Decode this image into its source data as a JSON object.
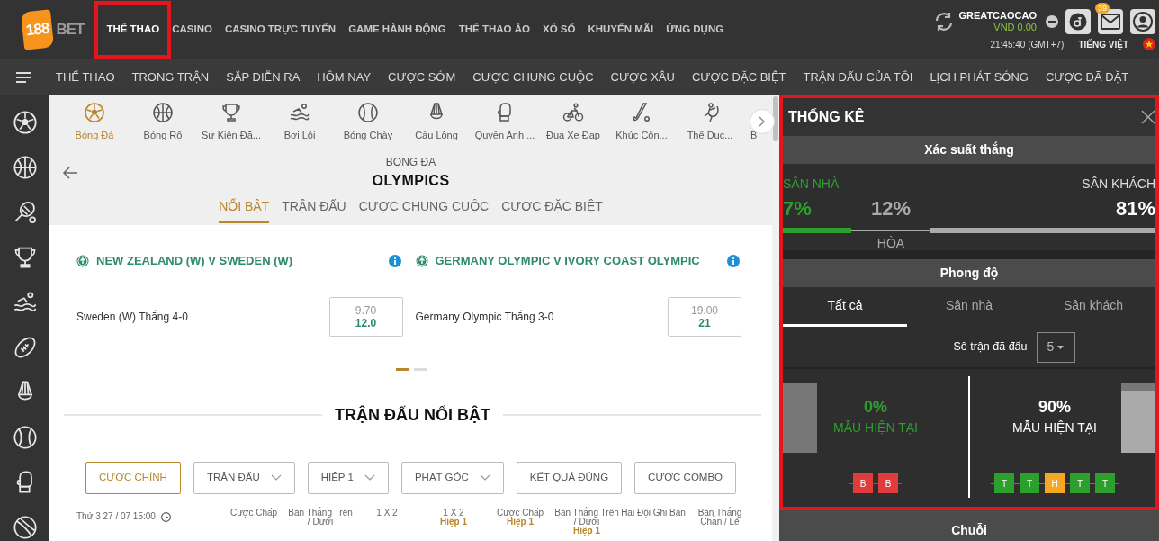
{
  "header": {
    "logo": {
      "part1": "188",
      "part2": "BET"
    },
    "nav": [
      {
        "label": "THỂ THAO",
        "selected": true,
        "highlighted": true
      },
      {
        "label": "CASINO",
        "selected": false,
        "highlighted": false
      },
      {
        "label": "CASINO TRỰC TUYẾN",
        "selected": false,
        "highlighted": false
      },
      {
        "label": "GAME HÀNH ĐỘNG",
        "selected": false,
        "highlighted": false
      },
      {
        "label": "THỂ THAO ẢO",
        "selected": false,
        "highlighted": false
      },
      {
        "label": "XỔ SỐ",
        "selected": false,
        "highlighted": false
      },
      {
        "label": "KHUYẾN MÃI",
        "selected": false,
        "highlighted": false
      },
      {
        "label": "ỨNG DỤNG",
        "selected": false,
        "highlighted": false
      }
    ],
    "account": {
      "username": "GREATCAOCAO",
      "balance": "VND 0.00",
      "mail_badge": "39",
      "time": "21:45:40 (GMT+7)",
      "language": "TIẾNG VIỆT"
    }
  },
  "subnav": [
    "THỂ THAO",
    "TRONG TRẬN",
    "SẮP DIỄN RA",
    "HÔM NAY",
    "CƯỢC SỚM",
    "CƯỢC CHUNG CUỘC",
    "CƯỢC XÂU",
    "CƯỢC ĐẶC BIỆT",
    "TRẬN ĐẤU CỦA TÔI",
    "LỊCH PHÁT SÓNG",
    "CƯỢC ĐÃ ĐẶT"
  ],
  "sports": [
    {
      "label": "Bóng Đá",
      "selected": true
    },
    {
      "label": "Bóng Rổ",
      "selected": false
    },
    {
      "label": "Sự Kiện Đặ...",
      "selected": false
    },
    {
      "label": "Bơi Lội",
      "selected": false
    },
    {
      "label": "Bóng Chày",
      "selected": false
    },
    {
      "label": "Cầu Lông",
      "selected": false
    },
    {
      "label": "Quyền Anh ...",
      "selected": false
    },
    {
      "label": "Đua Xe Đạp",
      "selected": false
    },
    {
      "label": "Khúc Côn...",
      "selected": false
    },
    {
      "label": "Thể Dục...",
      "selected": false
    },
    {
      "label": "B",
      "selected": false
    }
  ],
  "competition": {
    "sport": "BONG ĐA",
    "name": "OLYMPICS",
    "tabs": [
      {
        "label": "NỔI BẬT",
        "selected": true
      },
      {
        "label": "TRẬN ĐẤU",
        "selected": false
      },
      {
        "label": "CƯỢC CHUNG CUỘC",
        "selected": false
      },
      {
        "label": "CƯỢC ĐẶC BIỆT",
        "selected": false
      }
    ]
  },
  "featured": [
    {
      "title": "NEW ZEALAND (W) V SWEDEN (W)",
      "selection": "Sweden (W) Thắng 4-0",
      "old_odds": "9.70",
      "odds": "12.0"
    },
    {
      "title": "GERMANY OLYMPIC V IVORY COAST OLYMPIC",
      "selection": "Germany Olympic Thắng 3-0",
      "old_odds": "19.00",
      "odds": "21"
    }
  ],
  "carousel": [
    {
      "selected": true
    },
    {
      "selected": false
    }
  ],
  "section_title": "TRẬN ĐẤU NỔI BẬT",
  "filters": [
    {
      "label": "CƯỢC CHÍNH",
      "selected": true,
      "dropdown": false
    },
    {
      "label": "TRẬN ĐẤU",
      "selected": false,
      "dropdown": true
    },
    {
      "label": "HIỆP 1",
      "selected": false,
      "dropdown": true
    },
    {
      "label": "PHẠT GÓC",
      "selected": false,
      "dropdown": true
    },
    {
      "label": "KẾT QUẢ ĐÚNG",
      "selected": false,
      "dropdown": false
    },
    {
      "label": "CƯỢC COMBO",
      "selected": false,
      "dropdown": false
    }
  ],
  "table": {
    "date": "Thứ 3 27 / 07 15:00",
    "columns": [
      {
        "label": "Cược Chấp"
      },
      {
        "label": "Bàn Thắng Trên / Dưới"
      },
      {
        "label": "1 X 2"
      },
      {
        "label": "1 X 2",
        "sub": "Hiệp 1"
      },
      {
        "label": "Cược Chấp",
        "sub": "Hiệp 1"
      },
      {
        "label": "Bàn Thắng Trên / Dưới",
        "sub": "Hiệp 1"
      },
      {
        "label": "Hai Đội Ghi Bàn"
      },
      {
        "label": "Bàn Thắng Chẵn / Lẻ"
      }
    ]
  },
  "stats": {
    "title": "THỐNG KÊ",
    "highlighted": true,
    "win_probability": {
      "heading": "Xác suất thắng",
      "home_label": "SÂN NHÀ",
      "away_label": "SÂN KHÁCH",
      "home": "7%",
      "draw": "12%",
      "away": "81%",
      "draw_label": "HÒA"
    },
    "form": {
      "heading": "Phong độ",
      "tabs": [
        {
          "label": "Tất cả",
          "selected": true
        },
        {
          "label": "Sân nhà",
          "selected": false
        },
        {
          "label": "Sân khách",
          "selected": false
        }
      ],
      "matches_label": "Sô trận đã đấu",
      "matches_value": "5",
      "home": {
        "percent": "0%",
        "caption": "MẪU HIỆN TẠI",
        "level": 0,
        "results": [
          {
            "letter": "B",
            "color": "#e03c3c"
          },
          {
            "letter": "B",
            "color": "#e03c3c"
          }
        ]
      },
      "away": {
        "percent": "90%",
        "caption": "MẪU HIỆN TẠI",
        "level": 0.9,
        "results": [
          {
            "letter": "T",
            "color": "#2ca02c"
          },
          {
            "letter": "T",
            "color": "#2ca02c"
          },
          {
            "letter": "H",
            "color": "#f5a623"
          },
          {
            "letter": "T",
            "color": "#2ca02c"
          },
          {
            "letter": "T",
            "color": "#2ca02c"
          }
        ]
      }
    },
    "streak_heading": "Chuỗi"
  }
}
